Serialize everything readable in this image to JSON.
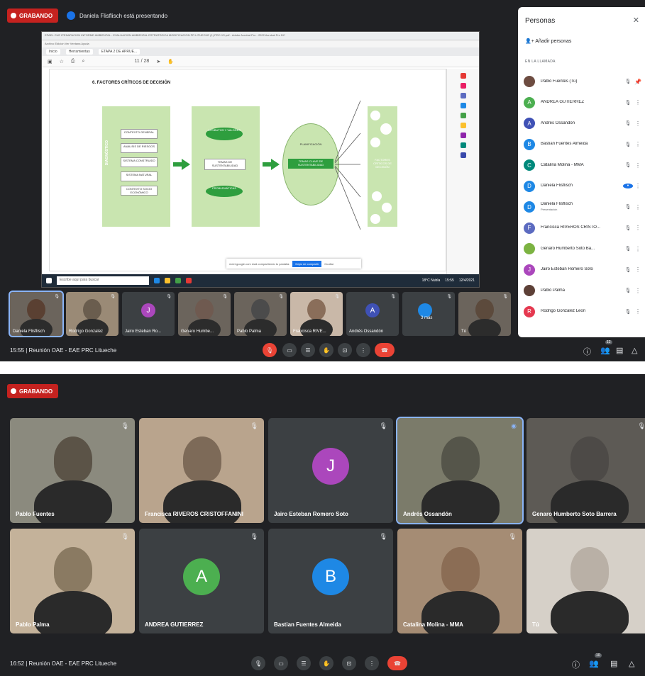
{
  "top": {
    "recording": "GRABANDO",
    "presenting": "Daniela Flisflisch está presentando",
    "shared": {
      "title_bar": "EPAEL CUE IPENAPACION INFORME AMBIENTAL - EVALUACION AMBIENTAL ESTRATEGICA MODIFICACION PR LITUECHE (1) PRC-1S.pdf - Adobe Acrobat Pro - 2022 Acrobat Pro DC",
      "menu": "Archivo  Edición  Ver  Ventana  Ayuda",
      "tabs": [
        "Inicio",
        "Herramientas",
        "ETAPA 2 DE APRUE..."
      ],
      "page_counter": "11 / 28",
      "heading": "6. FACTORES CRÍTICOS DE DECISIÓN",
      "left_label": "DIAGNÓSTICO",
      "left_items": [
        "CONTEXTO GENERAL",
        "ANÁLISIS DE RIESGOS",
        "SISTEMA CONSTRUIDO",
        "SISTEMA NATURAL",
        "CONTEXTO SOCIO ECONÓMICO"
      ],
      "mid_items": [
        "ATRIBUTOS Y VALORES",
        "TEMAS DE SUSTENTABILIDAD",
        "PROBLEMÁTICAS"
      ],
      "oval_top": "PLANIFICACIÓN",
      "oval_box": "TEMAS CLAVE DE SUSTENTABILIDAD",
      "right_label": "FACTORES CRÍTICOS DE DECISIÓN",
      "sharing_bar": "meet.google.com está compartiendo tu pantalla.",
      "sharing_stop": "Dejar de compartir",
      "sharing_hide": "Ocultar",
      "taskbar_search": "Escribe aquí para buscar",
      "taskbar_temp": "18°C Nubla",
      "taskbar_time": "15:55",
      "taskbar_date": "12/4/2021"
    },
    "people": {
      "title": "Personas",
      "add": "Añadir personas",
      "in_call": "EN LA LLAMADA",
      "list": [
        {
          "name": "Pablo Fuentes (Tú)",
          "initial": "",
          "color": "#6d4c41",
          "sub": ""
        },
        {
          "name": "ANDREA GUTIERREZ",
          "initial": "A",
          "color": "#4caf50",
          "sub": ""
        },
        {
          "name": "Andrés Ossandón",
          "initial": "A",
          "color": "#3f51b5",
          "sub": ""
        },
        {
          "name": "Bastian Fuentes Almeida",
          "initial": "B",
          "color": "#1e88e5",
          "sub": ""
        },
        {
          "name": "Catalina Molina - MMA",
          "initial": "C",
          "color": "#00897b",
          "sub": ""
        },
        {
          "name": "Daniela Flisflisch",
          "initial": "D",
          "color": "#1e88e5",
          "sub": ""
        },
        {
          "name": "Daniela Flisflisch",
          "initial": "D",
          "color": "#1e88e5",
          "sub": "Presentación"
        },
        {
          "name": "Francisca RIVEROS CRISTO...",
          "initial": "F",
          "color": "#5c6bc0",
          "sub": ""
        },
        {
          "name": "Genaro Humberto Soto Ba...",
          "initial": "",
          "color": "#7cb342",
          "sub": ""
        },
        {
          "name": "Jairo Esteban Romero Soto",
          "initial": "J",
          "color": "#ab47bc",
          "sub": ""
        },
        {
          "name": "Pablo Palma",
          "initial": "",
          "color": "#5d4037",
          "sub": ""
        },
        {
          "name": "Rodrigo Gonzalez Leon",
          "initial": "R",
          "color": "#e53950",
          "sub": ""
        }
      ]
    },
    "thumbs": [
      {
        "name": "Daniela Flisflisch",
        "initial": "",
        "color": "#5a4032"
      },
      {
        "name": "Rodrigo Gonzalez",
        "initial": "",
        "color": "#6a5d4e"
      },
      {
        "name": "Jairo Esteban Ro...",
        "initial": "J",
        "color": "#ab47bc"
      },
      {
        "name": "Genaro Humbe...",
        "initial": "",
        "color": "#6f5a50"
      },
      {
        "name": "Pablo Palma",
        "initial": "",
        "color": "#4b4b4b"
      },
      {
        "name": "Francisca RIVE...",
        "initial": "",
        "color": "#8a6e5a"
      },
      {
        "name": "Andrés Ossandón",
        "initial": "A",
        "color": "#3f51b5"
      },
      {
        "name": "3 más",
        "initial": "",
        "color": "#3c4043"
      },
      {
        "name": "Tú",
        "initial": "",
        "color": "#5c4a3c"
      }
    ],
    "bottom": {
      "time_meeting": "15:55  |  Reunión OAE - EAE PRC Litueche",
      "badge": "12"
    }
  },
  "bottomshot": {
    "recording": "GRABANDO",
    "tiles": [
      {
        "name": "Pablo Fuentes",
        "initial": "",
        "color": "#5b5347"
      },
      {
        "name": "Francisca RIVEROS CRISTOFFANINI",
        "initial": "",
        "color": "#7d6a58"
      },
      {
        "name": "Jairo Esteban Romero Soto",
        "initial": "J",
        "color": "#ab47bc"
      },
      {
        "name": "Andrés Ossandón",
        "initial": "",
        "color": "#55554a"
      },
      {
        "name": "Genaro Humberto Soto Barrera",
        "initial": "",
        "color": "#4d4a47"
      },
      {
        "name": "Pablo Palma",
        "initial": "",
        "color": "#8a7a62"
      },
      {
        "name": "ANDREA GUTIERREZ",
        "initial": "A",
        "color": "#4caf50"
      },
      {
        "name": "Bastian Fuentes Almeida",
        "initial": "B",
        "color": "#1e88e5"
      },
      {
        "name": "Catalina Molina - MMA",
        "initial": "",
        "color": "#8b6d55"
      },
      {
        "name": "Tú",
        "initial": "",
        "color": "#b9b0a6"
      }
    ],
    "bottom": {
      "time_meeting": "16:52  |  Reunión OAE - EAE PRC Litueche",
      "badge": "10"
    }
  },
  "colors": {
    "background": "#202124",
    "tile": "#3c4043",
    "record": "#c5221f",
    "end_call": "#ea4335",
    "accent": "#1a73e8"
  }
}
